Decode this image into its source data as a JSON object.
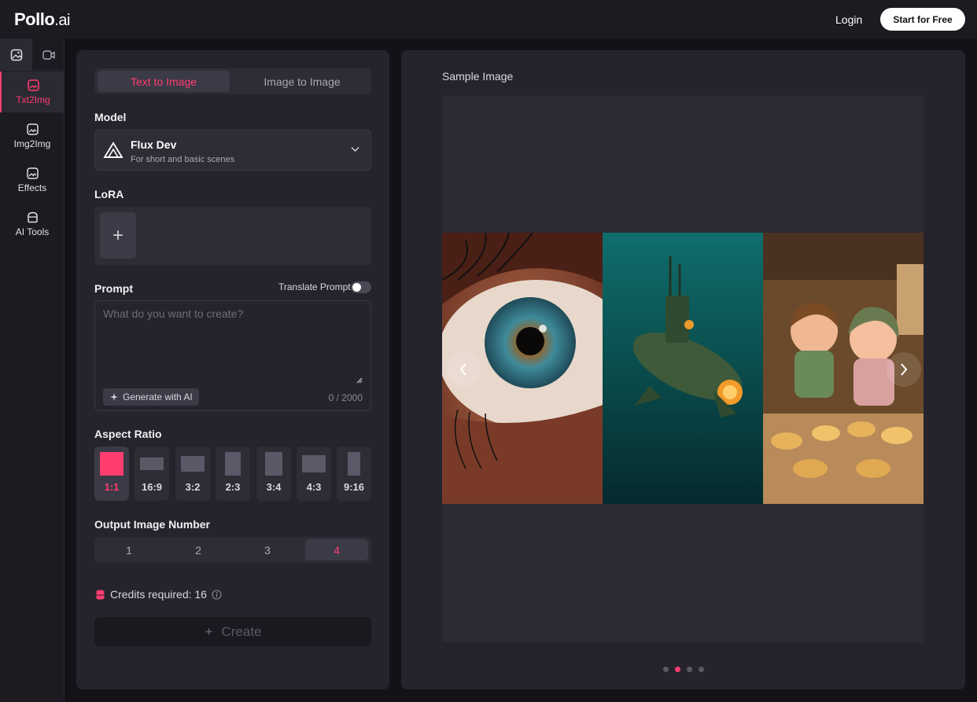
{
  "header": {
    "logo_main": "Pollo",
    "logo_suffix": ".ai",
    "login": "Login",
    "start": "Start for Free"
  },
  "rail": {
    "items": [
      {
        "label": "Txt2Img"
      },
      {
        "label": "Img2Img"
      },
      {
        "label": "Effects"
      },
      {
        "label": "AI Tools"
      }
    ]
  },
  "panel": {
    "tabs": [
      "Text to Image",
      "Image to Image"
    ],
    "model_label": "Model",
    "model_name": "Flux Dev",
    "model_desc": "For short and basic scenes",
    "lora_label": "LoRA",
    "lora_add": "+",
    "prompt_label": "Prompt",
    "translate_label": "Translate Prompt",
    "prompt_placeholder": "What do you want to create?",
    "generate_ai": "Generate with AI",
    "counter": "0 / 2000",
    "aspect_label": "Aspect Ratio",
    "ratios": [
      "1:1",
      "16:9",
      "3:2",
      "2:3",
      "3:4",
      "4:3",
      "9:16"
    ],
    "output_label": "Output Image Number",
    "output_numbers": [
      "1",
      "2",
      "3",
      "4"
    ],
    "credits": "Credits required: 16",
    "create": "Create"
  },
  "sample": {
    "title": "Sample Image",
    "pagination": 4,
    "current_page": 2
  },
  "colors": {
    "accent": "#ff3d6e",
    "panel": "#25242c",
    "background": "#131218"
  }
}
